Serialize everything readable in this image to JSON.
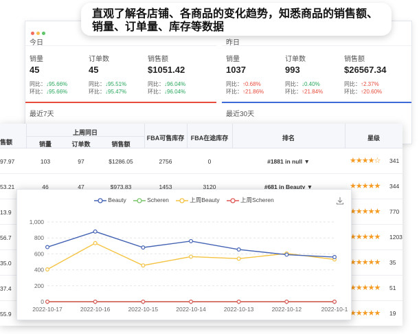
{
  "banner": {
    "line1": "直观了解各店铺、各商品的变化趋势，知悉商品的销售额、",
    "line2": "销量、订单量、库存等数据"
  },
  "today": {
    "title": "今日",
    "metrics": [
      {
        "label": "销量",
        "value": "45",
        "yoy": "↓95.66%",
        "mom": "↓95.66%",
        "dir": "down"
      },
      {
        "label": "订单数",
        "value": "45",
        "yoy": "↓95.51%",
        "mom": "↓95.47%",
        "dir": "down"
      },
      {
        "label": "销售额",
        "value": "$1051.42",
        "yoy": "↓96.04%",
        "mom": "↓96.04%",
        "dir": "down"
      }
    ]
  },
  "yesterday": {
    "title": "昨日",
    "metrics": [
      {
        "label": "销量",
        "value": "1037",
        "yoy": "↑0.68%",
        "mom": "↑21.86%",
        "yoyDir": "up",
        "momDir": "up"
      },
      {
        "label": "订单数",
        "value": "993",
        "yoy": "↓0.40%",
        "mom": "↑21.84%",
        "yoyDir": "down",
        "momDir": "up"
      },
      {
        "label": "销售额",
        "value": "$26567.34",
        "yoy": "↑2.37%",
        "mom": "↑20.60%",
        "yoyDir": "up",
        "momDir": "up"
      }
    ]
  },
  "compare": {
    "yoy_label": "同比：",
    "mom_label": "环比："
  },
  "last7": {
    "title": "最近7天"
  },
  "last30": {
    "title": "最近30天"
  },
  "table": {
    "group_header": "上周同日",
    "headers": {
      "sales_amount": "售额",
      "qty": "销量",
      "orders": "订单数",
      "amount": "销售额",
      "fba_stock": "FBA可售库存",
      "fba_inbound": "FBA在途库存",
      "rank": "排名",
      "stars": "星级"
    },
    "rows": [
      {
        "sales": "97.97",
        "qty": "103",
        "orders": "97",
        "amount": "$1286.05",
        "fba": "2756",
        "inbound": "0",
        "rank": "#1881 in null ▼",
        "stars": "★★★★☆",
        "rating": "341"
      },
      {
        "sales": "53.21",
        "qty": "46",
        "orders": "47",
        "amount": "$973.83",
        "fba": "1453",
        "inbound": "3120",
        "rank": "#681 in Beauty ▼",
        "stars": "★★★★★",
        "rating": "344"
      },
      {
        "sales": "13.9",
        "stars": "★★★★★",
        "rating": "770"
      },
      {
        "sales": "56.7",
        "stars": "★★★★★",
        "rating": "1203"
      },
      {
        "sales": "35.0",
        "stars": "★★★★★",
        "rating": "35"
      },
      {
        "sales": "37.4",
        "stars": "★★★★★",
        "rating": "51"
      },
      {
        "sales": "55.9",
        "stars": "★★★★★",
        "rating": "19"
      }
    ]
  },
  "chart_data": {
    "type": "line",
    "x": [
      "2022-10-17",
      "2022-10-16",
      "2022-10-15",
      "2022-10-14",
      "2022-10-13",
      "2022-10-12",
      "2022-10-1"
    ],
    "ylim": [
      0,
      1000
    ],
    "yticks": [
      "0",
      "200",
      "400",
      "600",
      "800",
      "1,000"
    ],
    "series": [
      {
        "name": "Beauty",
        "color": "#4463b4",
        "values": [
          685,
          880,
          680,
          760,
          655,
          590,
          560
        ]
      },
      {
        "name": "Scheren",
        "color": "#7cc46a",
        "values": [
          0,
          0,
          0,
          0,
          0,
          0,
          0
        ]
      },
      {
        "name": "上周Beauty",
        "color": "#f5c342",
        "values": [
          405,
          735,
          455,
          565,
          540,
          605,
          530
        ]
      },
      {
        "name": "上周Scheren",
        "color": "#e05757",
        "values": [
          0,
          0,
          0,
          0,
          0,
          0,
          0
        ]
      }
    ],
    "grid": true,
    "legend": "top-center"
  }
}
